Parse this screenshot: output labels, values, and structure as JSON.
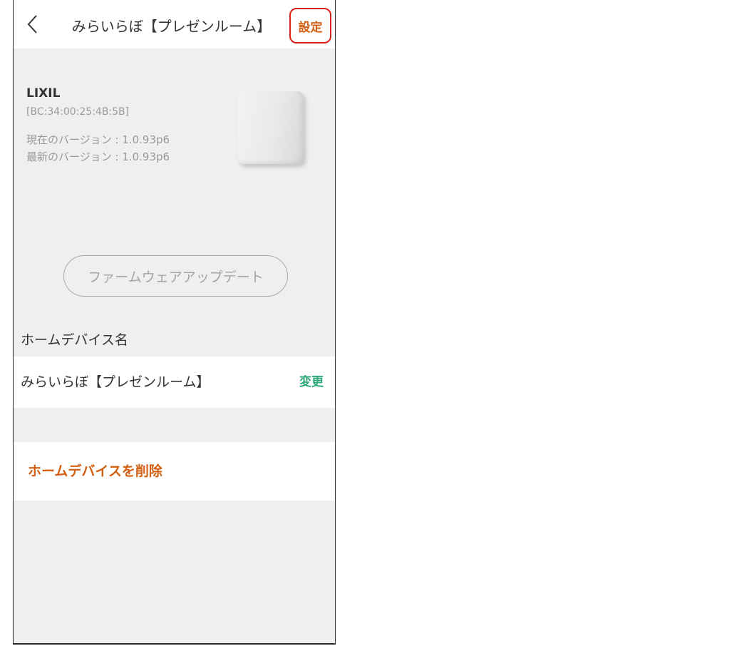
{
  "header": {
    "title": "みらいらぼ【プレゼンルーム】",
    "back_icon": "chevron-left-icon",
    "settings_label": "設定",
    "settings_highlight_color": "#d8231e"
  },
  "device": {
    "brand": "LIXIL",
    "mac": "[BC:34:00:25:4B:5B]",
    "current_version": "現在のバージョン : 1.0.93p6",
    "latest_version": "最新のバージョン : 1.0.93p6"
  },
  "firmware_button": {
    "label": "ファームウェアアップデート",
    "state": "disabled"
  },
  "home_device_name": {
    "section_label": "ホームデバイス名",
    "value": "みらいらぼ【プレゼンルーム】",
    "change_label": "変更"
  },
  "delete": {
    "label": "ホームデバイスを削除"
  },
  "colors": {
    "accent_orange": "#d25f12",
    "accent_green": "#2ea879",
    "background": "#efefef"
  }
}
